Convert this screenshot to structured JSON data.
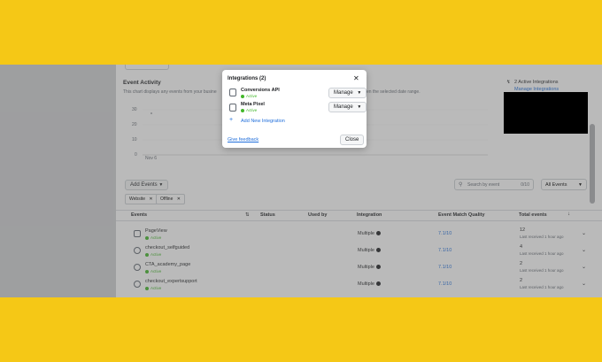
{
  "chart": {
    "title": "Event Activity",
    "description_left": "This chart displays any events from your busine",
    "description_right": "en the selected date range.",
    "y_ticks": [
      "30",
      "20",
      "10",
      "0"
    ],
    "x_label": "Nov 6"
  },
  "side": {
    "active_integrations": "2 Active Integrations",
    "manage_link": "Manage Integrations"
  },
  "toolbar": {
    "add_events": "Add Events",
    "search_placeholder": "Search by event",
    "search_count": "0/10",
    "filter_value": "All Events"
  },
  "chips": [
    {
      "label": "Website"
    },
    {
      "label": "Offline"
    }
  ],
  "table": {
    "headers": [
      "Events",
      "Status",
      "Used by",
      "Integration",
      "Event Match Quality",
      "Total events"
    ],
    "rows": [
      {
        "name": "PageView",
        "status": "Active",
        "integration": "Multiple",
        "emq": "7.1/10",
        "total": "12",
        "last": "Last received 1 hour ago"
      },
      {
        "name": "checkout_selfguided",
        "status": "Active",
        "integration": "Multiple",
        "emq": "7.1/10",
        "total": "4",
        "last": "Last received 1 hour ago"
      },
      {
        "name": "CTA_academy_page",
        "status": "Active",
        "integration": "Multiple",
        "emq": "7.1/10",
        "total": "2",
        "last": "Last received 1 hour ago"
      },
      {
        "name": "checkout_expertsupport",
        "status": "Active",
        "integration": "Multiple",
        "emq": "7.1/10",
        "total": "2",
        "last": "Last received 1 hour ago"
      }
    ]
  },
  "modal": {
    "title": "Integrations (2)",
    "items": [
      {
        "name": "Conversions API",
        "status": "Active",
        "action": "Manage"
      },
      {
        "name": "Meta Pixel",
        "status": "Active",
        "action": "Manage"
      }
    ],
    "add_new": "Add New Integration",
    "feedback": "Give feedback",
    "close": "Close"
  }
}
